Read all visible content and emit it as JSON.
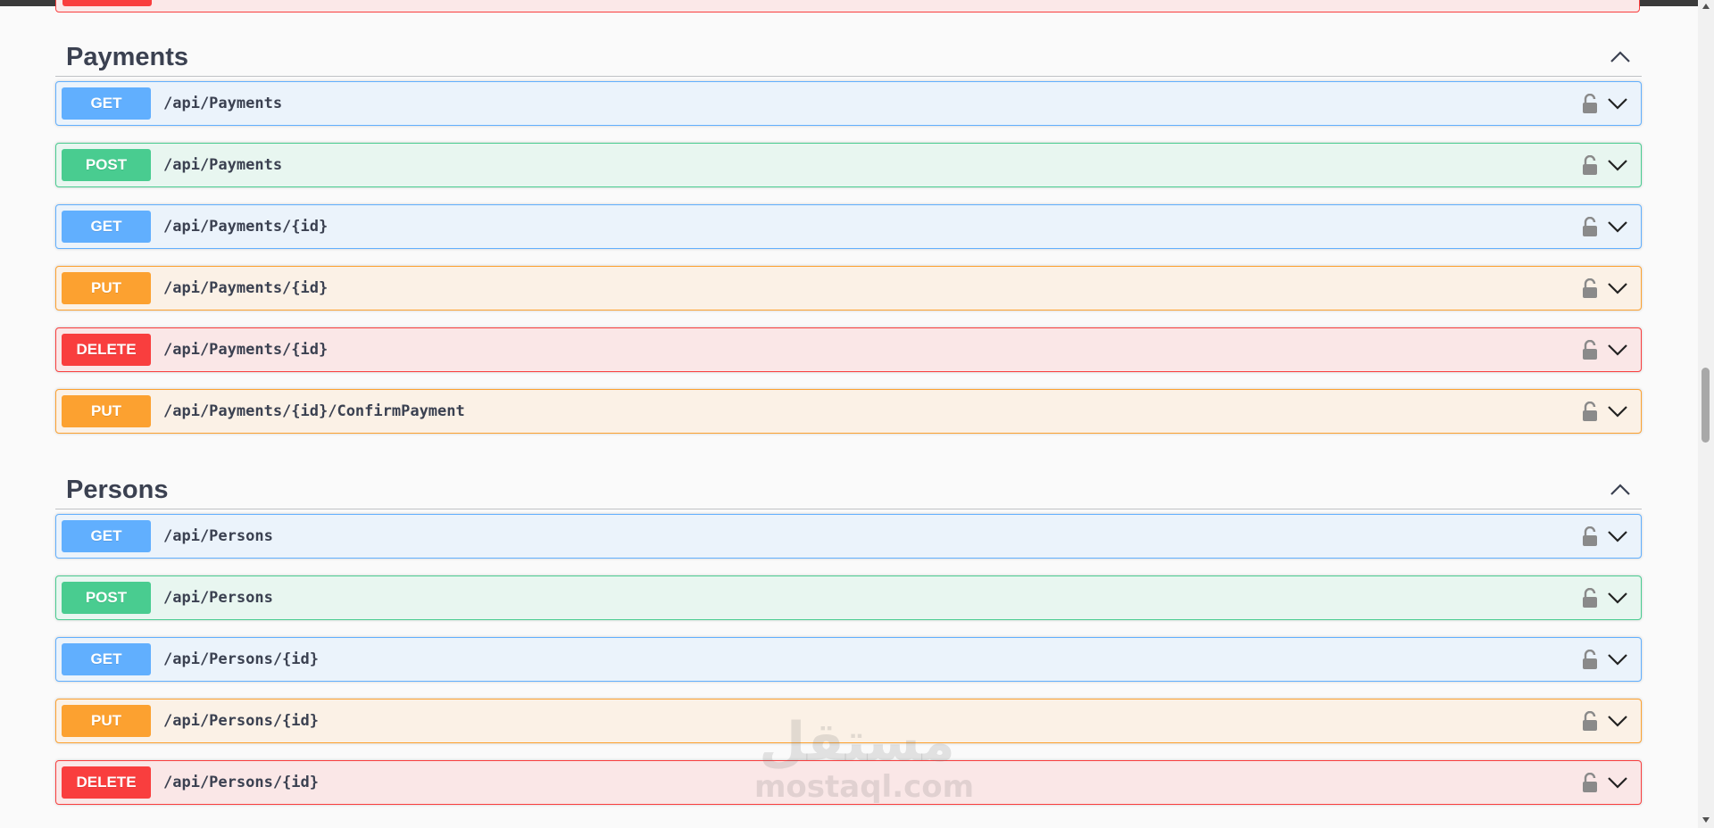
{
  "colors": {
    "get": "#61affe",
    "post": "#49cc90",
    "put": "#fca130",
    "delete": "#f93e3e"
  },
  "sections": [
    {
      "title": "Payments",
      "operations": [
        {
          "method": "GET",
          "path": "/api/Payments"
        },
        {
          "method": "POST",
          "path": "/api/Payments"
        },
        {
          "method": "GET",
          "path": "/api/Payments/{id}"
        },
        {
          "method": "PUT",
          "path": "/api/Payments/{id}"
        },
        {
          "method": "DELETE",
          "path": "/api/Payments/{id}"
        },
        {
          "method": "PUT",
          "path": "/api/Payments/{id}/ConfirmPayment"
        }
      ]
    },
    {
      "title": "Persons",
      "operations": [
        {
          "method": "GET",
          "path": "/api/Persons"
        },
        {
          "method": "POST",
          "path": "/api/Persons"
        },
        {
          "method": "GET",
          "path": "/api/Persons/{id}"
        },
        {
          "method": "PUT",
          "path": "/api/Persons/{id}"
        },
        {
          "method": "DELETE",
          "path": "/api/Persons/{id}"
        }
      ]
    }
  ],
  "watermark": {
    "arabic": "مستقل",
    "latin": "mostaql.com"
  },
  "icons": {
    "lock": "lock-icon",
    "expand": "chevron-down-icon",
    "collapse": "chevron-up-icon"
  }
}
